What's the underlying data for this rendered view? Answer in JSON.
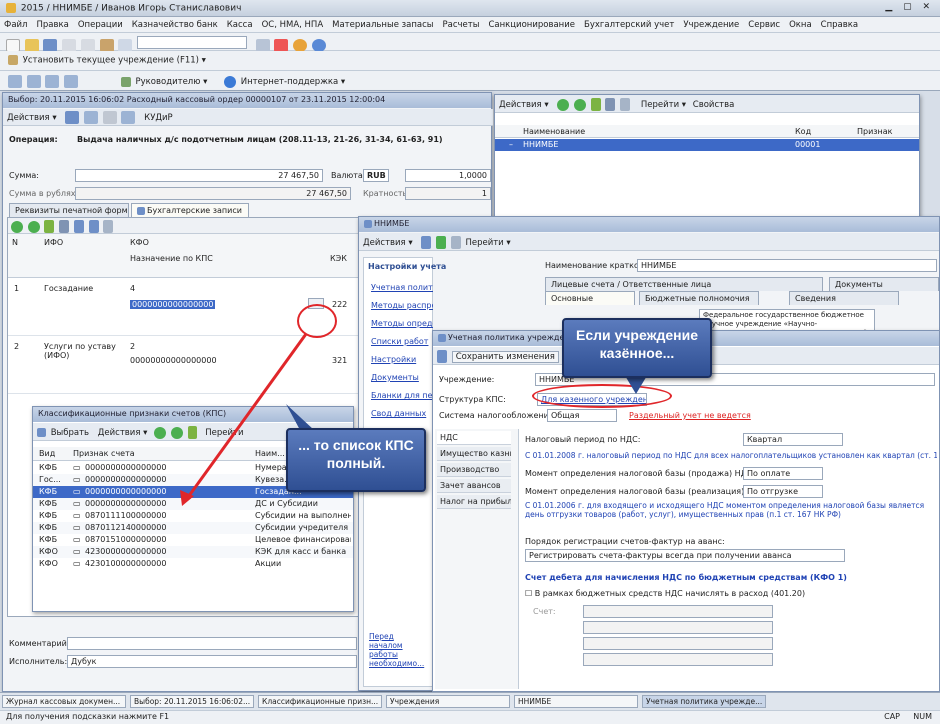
{
  "app": {
    "title": "2015 / ННИМБЕ / Иванов Игорь Станиславович"
  },
  "menu": [
    "Файл",
    "Правка",
    "Операции",
    "Казначейство банк",
    "Касса",
    "ОС, НМА, НПА",
    "Материальные запасы",
    "Расчеты",
    "Санкционирование",
    "Бухгалтерский учет",
    "Учреждение",
    "Сервис",
    "Окна",
    "Справка"
  ],
  "toolbar3": {
    "policy": "Установить текущее учреждение (F11)"
  },
  "toolbar4": {
    "manager": "Руководителю",
    "support": "Интернет-поддержка"
  },
  "doc": {
    "title": "Выбор: 20.11.2015 16:06:02 Расходный кассовый ордер 00000107 от 23.11.2015 12:00:04",
    "actions": "Действия",
    "goto": "КУДиР",
    "operation_label": "Операция:",
    "operation_value": "Выдача наличных д/с подотчетным лицам (208.11-13, 21-26, 31-34, 61-63, 91)",
    "sum_label": "Сумма:",
    "sum_value": "27 467,50",
    "currency_label": "Валюта:",
    "currency_value": "RUB",
    "rub_label": "Сумма в рублях:",
    "rub_value": "27 467,50",
    "rate_label": "Кратность:",
    "rate_value": "1",
    "rate2_value": "1,0000",
    "tab1": "Реквизиты печатной формы",
    "tab2": "Бухгалтерские записи",
    "col_no": "N",
    "col_ifo": "ИФО",
    "col_kfo": "КФО",
    "col_kps": "Назначение по КПС",
    "col_kek": "КЭК",
    "rows": [
      {
        "no": "1",
        "ifo": "Госзадание",
        "kfo": "4",
        "kps": "0000000000000000",
        "kek": "222"
      },
      {
        "no": "2",
        "ifo": "Услуги по уставу (ИФО)",
        "kfo": "2",
        "kps": "00000000000000000",
        "kek": "321"
      }
    ],
    "comment_label": "Комментарий:",
    "exec_label": "Исполнитель:",
    "exec_value": "Дубук"
  },
  "kps_list": {
    "title": "Классификационные признаки счетов (КПС)",
    "select": "Выбрать",
    "actions": "Действия",
    "goto": "Перейти",
    "col_type": "Вид",
    "col_code": "Признак счета",
    "col_name": "Наим...",
    "rows": [
      {
        "type": "КФБ",
        "code": "0000000000000000",
        "name": "Нумера..."
      },
      {
        "type": "Гос...",
        "code": "0000000000000000",
        "name": "Кувеза..."
      },
      {
        "type": "КФБ",
        "code": "0000000000000000",
        "name": "Госзадан..."
      },
      {
        "type": "КФБ",
        "code": "0000000000000000",
        "name": "ДС и Субсидии"
      },
      {
        "type": "КФБ",
        "code": "0870111100000000",
        "name": "Субсидии на выполнение"
      },
      {
        "type": "КФБ",
        "code": "0870112140000000",
        "name": "Субсидии учредителя 20..."
      },
      {
        "type": "КФБ",
        "code": "0870151000000000",
        "name": "Целевое финансирование"
      },
      {
        "type": "КФО",
        "code": "4230000000000000",
        "name": "КЭК для касс и банка"
      },
      {
        "type": "КФО",
        "code": "4230100000000000",
        "name": "Акции"
      }
    ]
  },
  "right_top": {
    "actions": "Действия",
    "goto": "Перейти",
    "props": "Свойства",
    "col_name": "Наименование",
    "col_code": "Код",
    "col_sign": "Признак",
    "row_name": "ННИМБЕ",
    "row_code": "00001"
  },
  "org": {
    "title": "ННИМБЕ",
    "actions": "Действия",
    "goto": "Перейти",
    "settings_title": "Настройки учета",
    "nav": [
      "Учетная политика учреждения",
      "Методы распределения общих затрат",
      "Методы определения прямых расходов",
      "Списки работ",
      "Настройки",
      "Документы",
      "Бланки для печати",
      "Свод данных",
      "Разрешения"
    ],
    "bottom_link": "Перед началом работы необходимо...",
    "name_label": "Наименование краткое:",
    "name_value": "ННИМБЕ",
    "tabs": [
      "Лицевые счета / Ответственные лица",
      "Документы"
    ],
    "subtabs": [
      "Основные",
      "Бюджетные полномочия",
      "Сведения"
    ],
    "full_name": "Федеральное государственное бюджетное научное учреждение «Научно-исследовательский институт молекулярной биологии и..."
  },
  "policy": {
    "title": "Учетная политика учреждения",
    "save": "Сохранить изменения",
    "org_label": "Учреждение:",
    "org_value": "ННИМБЕ",
    "struct_label": "Структура КПС:",
    "struct_value": "Для казенного учреждения",
    "tax_label": "Система налогообложения:",
    "tax_value": "Общая",
    "tax_note": "Раздельный учет не ведется",
    "side": [
      "НДС",
      "Имущество казны",
      "Производство",
      "Зачет авансов",
      "Налог на прибыль"
    ],
    "period_label": "Налоговый период по НДС:",
    "period_value": "Квартал",
    "note1": "С 01.01.2008 г. налоговый период по НДС для всех налогоплательщиков установлен как квартал (ст. 163 НК РФ)",
    "m1_label": "Момент определения налоговой базы (продажа) НДС:",
    "m1_value": "По оплате",
    "m2_label": "Момент определения налоговой базы (реализация) НДС:",
    "m2_value": "По отгрузке",
    "note2": "С 01.01.2006 г. для входящего и исходящего НДС моментом определения налоговой базы является день отгрузки товаров (работ, услуг), имущественных прав (п.1 ст. 167 НК РФ)",
    "reg_label": "Порядок регистрации счетов-фактур на аванс:",
    "reg_value": "Регистрировать счета-фактуры всегда при получении аванса",
    "vat_header": "Счет дебета для начисления НДС по бюджетным средствам (КФО 1)",
    "vat_check": "В рамках бюджетных средств НДС начислять в расход (401.20)",
    "acc_label": "Счет:"
  },
  "callouts": {
    "kazennoe": "Если учреждение казённое...",
    "kps_full": "... то список КПС полный."
  },
  "taskbar": [
    "Журнал кассовых докумен...",
    "Выбор: 20.11.2015 16:06:02...",
    "Классификационные призн...",
    "Учреждения",
    "ННИМБЕ",
    "Учетная политика учрежде..."
  ],
  "status": {
    "hint": "Для получения подсказки нажмите F1",
    "caps": "CAP",
    "num": "NUM"
  },
  "colors": {
    "accent": "#2f4f93",
    "red": "#e0262a",
    "select": "#3d69c7"
  }
}
